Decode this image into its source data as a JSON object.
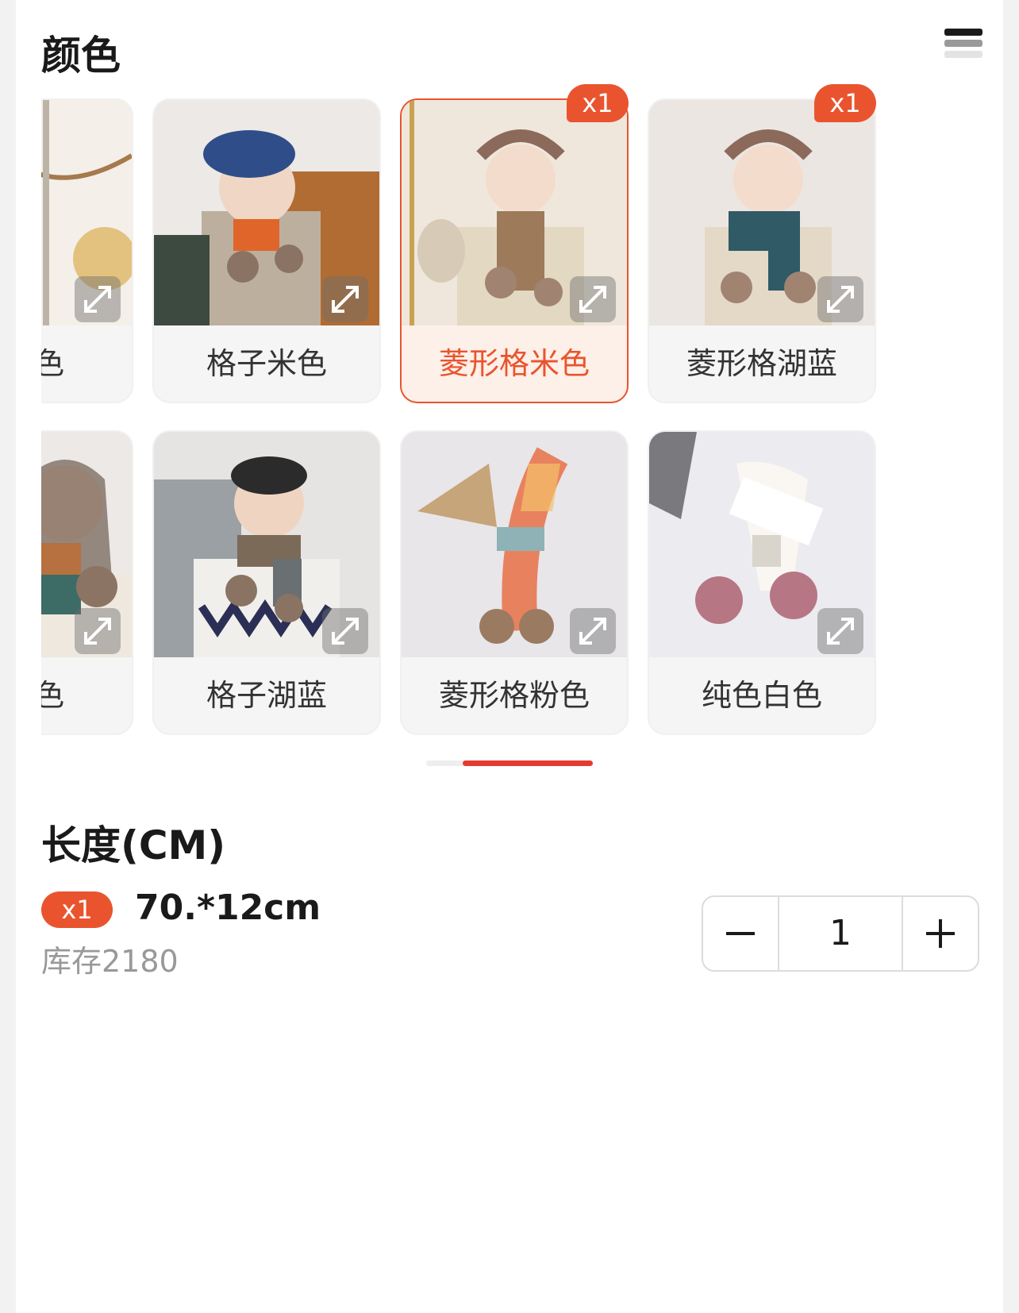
{
  "color_section": {
    "title": "颜色",
    "options": [
      {
        "label": "格粉色",
        "badge": ""
      },
      {
        "label": "格子米色",
        "badge": ""
      },
      {
        "label": "菱形格米色",
        "badge": "x1",
        "selected": true
      },
      {
        "label": "菱形格湖蓝",
        "badge": "x1"
      },
      {
        "label": "子橘色",
        "badge": ""
      },
      {
        "label": "格子湖蓝",
        "badge": ""
      },
      {
        "label": "菱形格粉色",
        "badge": ""
      },
      {
        "label": "纯色白色",
        "badge": ""
      }
    ]
  },
  "length_section": {
    "title": "长度(CM)",
    "spec": {
      "badge": "x1",
      "name": "70.*12cm",
      "stock": "库存2180"
    },
    "quantity": {
      "value": "1",
      "decrement_icon": "minus-icon",
      "increment_icon": "plus-icon"
    }
  },
  "colors": {
    "accent": "#e9542e",
    "indicator": "#e53a2f",
    "selected_bg": "#fdf0e8"
  },
  "icons": {
    "menu": "menu-icon",
    "expand": "expand-icon"
  }
}
